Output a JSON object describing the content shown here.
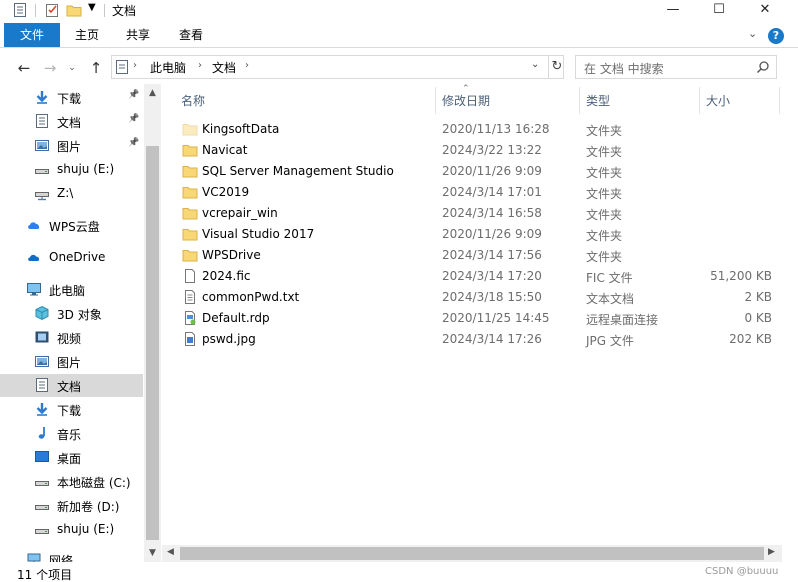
{
  "window": {
    "title": "文档"
  },
  "ribbon": {
    "tabs": [
      "文件",
      "主页",
      "共享",
      "查看"
    ],
    "help_label": "?"
  },
  "window_controls": {
    "minimize": "—",
    "maximize": "☐",
    "close": "✕"
  },
  "address": {
    "crumbs": [
      "此电脑",
      "文档"
    ],
    "search_placeholder": "在 文档 中搜索"
  },
  "nav": {
    "items": [
      {
        "label": "下载",
        "icon": "download-arrow-icon",
        "pinned": true
      },
      {
        "label": "文档",
        "icon": "document-icon",
        "pinned": true
      },
      {
        "label": "图片",
        "icon": "picture-icon",
        "pinned": true
      },
      {
        "label": "shuju (E:)",
        "icon": "drive-icon",
        "pinned": false
      },
      {
        "label": "Z:\\",
        "icon": "network-drive-icon",
        "pinned": false
      },
      {
        "label": "WPS云盘",
        "icon": "wps-cloud-icon",
        "pinned": false
      },
      {
        "label": "OneDrive",
        "icon": "onedrive-cloud-icon",
        "pinned": false
      },
      {
        "label": "此电脑",
        "icon": "computer-icon",
        "pinned": false
      },
      {
        "label": "3D 对象",
        "icon": "cube-3d-icon",
        "pinned": false
      },
      {
        "label": "视频",
        "icon": "video-icon",
        "pinned": false
      },
      {
        "label": "图片",
        "icon": "picture-icon",
        "pinned": false
      },
      {
        "label": "文档",
        "icon": "document-icon",
        "pinned": false,
        "selected": true
      },
      {
        "label": "下载",
        "icon": "download-arrow-icon",
        "pinned": false
      },
      {
        "label": "音乐",
        "icon": "music-note-icon",
        "pinned": false
      },
      {
        "label": "桌面",
        "icon": "desktop-icon",
        "pinned": false
      },
      {
        "label": "本地磁盘 (C:)",
        "icon": "drive-icon",
        "pinned": false
      },
      {
        "label": "新加卷 (D:)",
        "icon": "drive-icon",
        "pinned": false
      },
      {
        "label": "shuju (E:)",
        "icon": "drive-icon",
        "pinned": false
      },
      {
        "label": "网络",
        "icon": "network-icon",
        "pinned": false
      }
    ]
  },
  "columns": {
    "name": "名称",
    "date": "修改日期",
    "type": "类型",
    "size": "大小"
  },
  "files": [
    {
      "name": "KingsoftData",
      "date": "2020/11/13 16:28",
      "type": "文件夹",
      "size": "",
      "icon": "folder-icon",
      "faded": true
    },
    {
      "name": "Navicat",
      "date": "2024/3/22 13:22",
      "type": "文件夹",
      "size": "",
      "icon": "folder-icon"
    },
    {
      "name": "SQL Server Management Studio",
      "date": "2020/11/26 9:09",
      "type": "文件夹",
      "size": "",
      "icon": "folder-icon"
    },
    {
      "name": "VC2019",
      "date": "2024/3/14 17:01",
      "type": "文件夹",
      "size": "",
      "icon": "folder-icon"
    },
    {
      "name": "vcrepair_win",
      "date": "2024/3/14 16:58",
      "type": "文件夹",
      "size": "",
      "icon": "folder-icon"
    },
    {
      "name": "Visual Studio 2017",
      "date": "2020/11/26 9:09",
      "type": "文件夹",
      "size": "",
      "icon": "folder-icon"
    },
    {
      "name": "WPSDrive",
      "date": "2024/3/14 17:56",
      "type": "文件夹",
      "size": "",
      "icon": "folder-icon"
    },
    {
      "name": "2024.fic",
      "date": "2024/3/14 17:20",
      "type": "FIC 文件",
      "size": "51,200 KB",
      "icon": "blank-file-icon"
    },
    {
      "name": "commonPwd.txt",
      "date": "2024/3/18 15:50",
      "type": "文本文档",
      "size": "2 KB",
      "icon": "text-file-icon"
    },
    {
      "name": "Default.rdp",
      "date": "2020/11/25 14:45",
      "type": "远程桌面连接",
      "size": "0 KB",
      "icon": "remote-desktop-file-icon"
    },
    {
      "name": "pswd.jpg",
      "date": "2024/3/14 17:26",
      "type": "JPG 文件",
      "size": "202 KB",
      "icon": "image-file-icon"
    }
  ],
  "status": {
    "item_count": "11 个项目"
  },
  "watermark": "CSDN @buuuu"
}
